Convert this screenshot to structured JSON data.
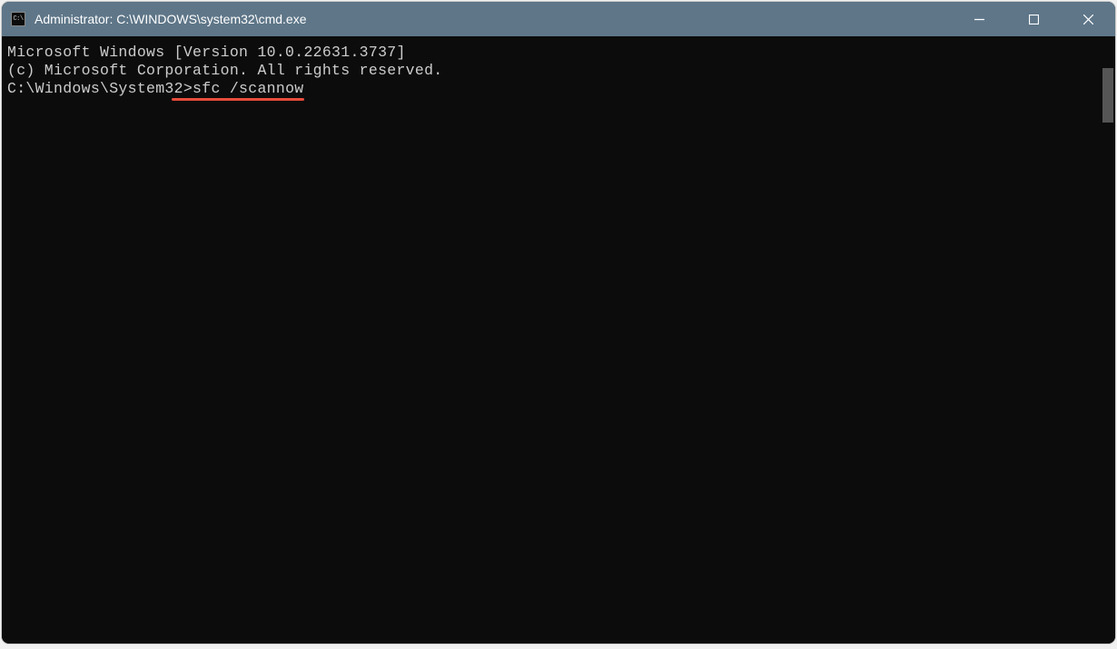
{
  "window": {
    "title": "Administrator: C:\\WINDOWS\\system32\\cmd.exe",
    "icon_label": "C:\\"
  },
  "terminal": {
    "line1": "Microsoft Windows [Version 10.0.22631.3737]",
    "line2": "(c) Microsoft Corporation. All rights reserved.",
    "blank": "",
    "prompt": "C:\\Windows\\System32>",
    "command": "sfc /scannow"
  },
  "annotation": {
    "underline_color": "#e74c3c"
  }
}
